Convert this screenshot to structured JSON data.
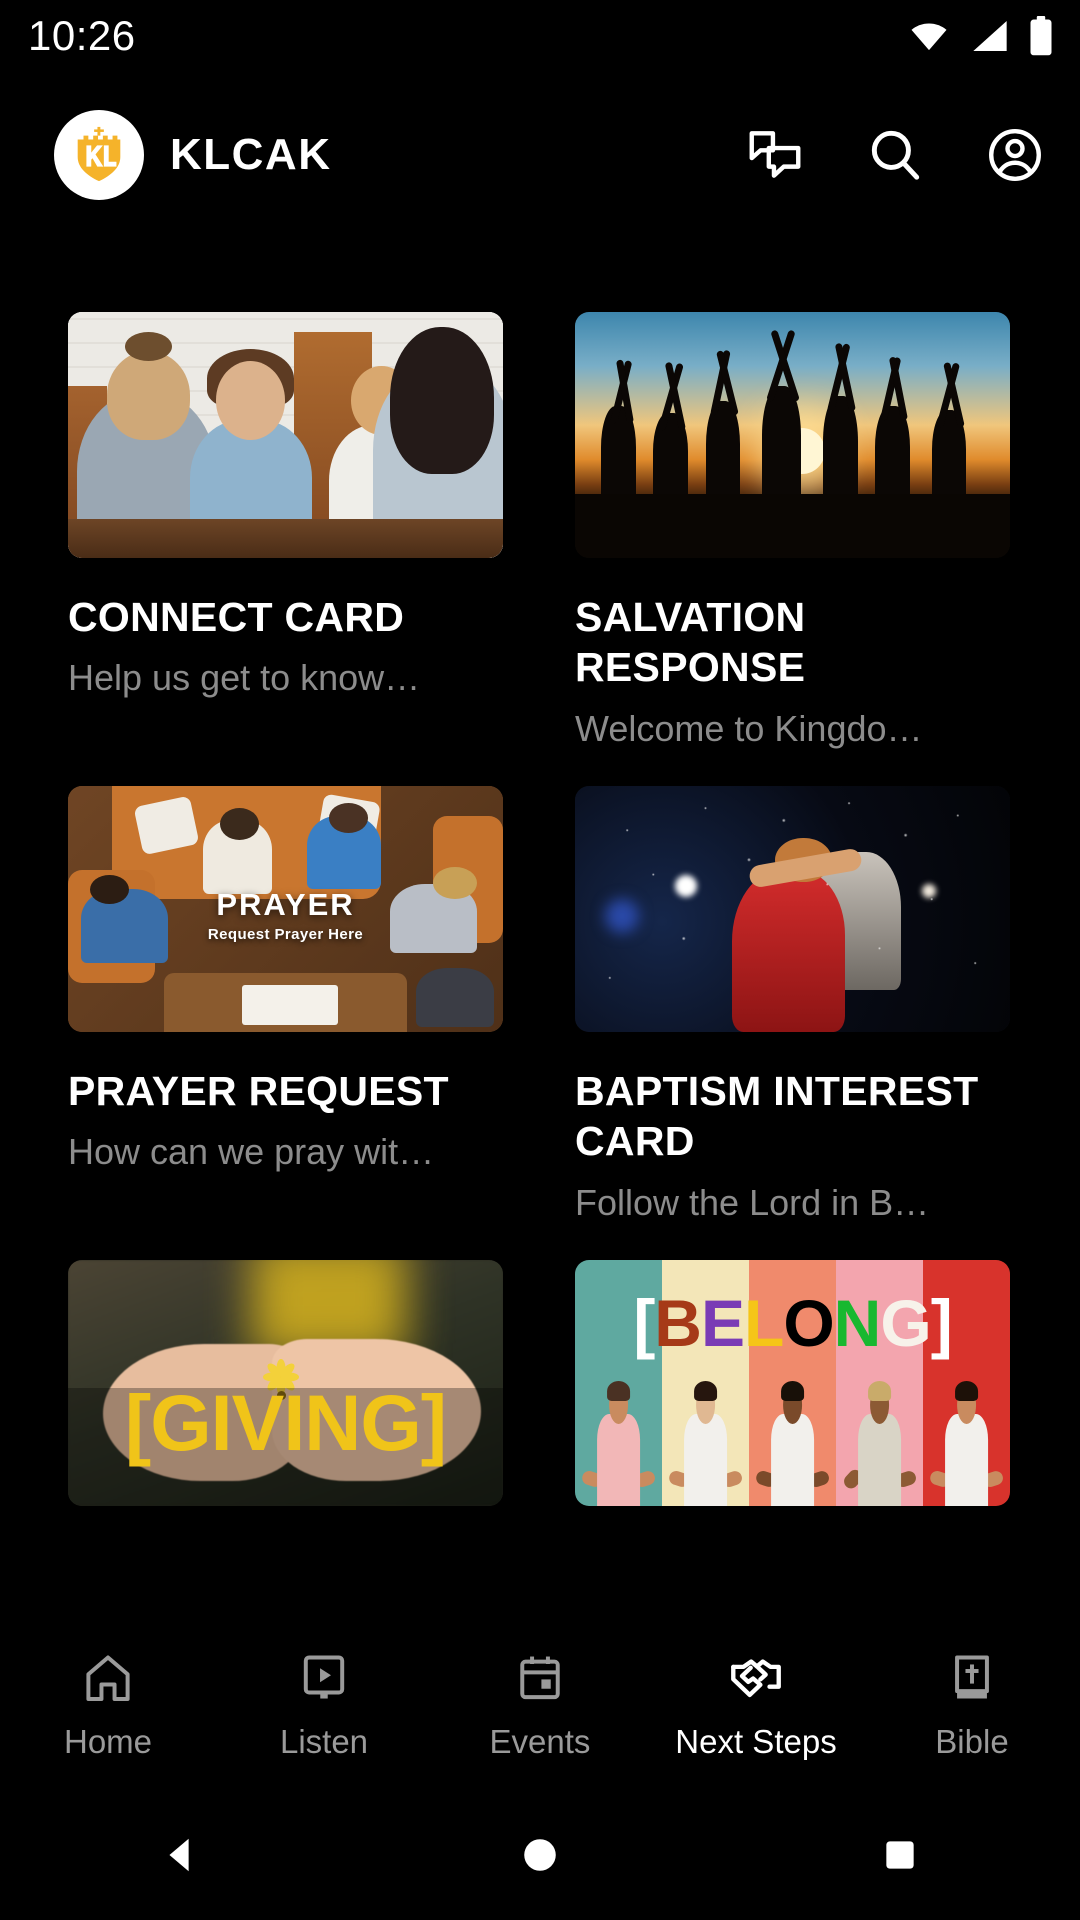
{
  "status_bar": {
    "time": "10:26",
    "icons": [
      "wifi-icon",
      "cellular-signal-icon",
      "battery-icon"
    ]
  },
  "header": {
    "logo_alt": "klcak-logo",
    "brand_name": "KLCAK",
    "logo_color": "#f5b32a",
    "actions": [
      {
        "name": "chat-icon",
        "label": "Chat"
      },
      {
        "name": "search-icon",
        "label": "Search"
      },
      {
        "name": "account-icon",
        "label": "Account"
      }
    ]
  },
  "cards": [
    {
      "title": "CONNECT CARD",
      "subtitle": "Help us get to know…",
      "art": "people-at-table-photo"
    },
    {
      "title": "SALVATION RESPONSE",
      "subtitle": "Welcome to Kingdo…",
      "art": "raised-hands-sunset-photo"
    },
    {
      "title": "PRAYER REQUEST",
      "subtitle": "How can we pray wit…",
      "art": "prayer-circle-photo",
      "overlay_title": "PRAYER",
      "overlay_subtitle": "Request Prayer Here"
    },
    {
      "title": "BAPTISM INTEREST CARD",
      "subtitle": "Follow the Lord in B…",
      "art": "baptism-embrace-photo"
    },
    {
      "title": "",
      "subtitle": "",
      "art": "giving-hands-flower-photo",
      "overlay_title": "[GIVING]",
      "overlay_color": "#f0c419"
    },
    {
      "title": "",
      "subtitle": "",
      "art": "belong-people-stripes-photo",
      "overlay_letters": [
        {
          "char": "[",
          "color": "#ffffff"
        },
        {
          "char": "B",
          "color": "#a63a18"
        },
        {
          "char": "E",
          "color": "#7a3bb5"
        },
        {
          "char": "L",
          "color": "#f5c518"
        },
        {
          "char": "O",
          "color": "#000000"
        },
        {
          "char": "N",
          "color": "#18b830"
        },
        {
          "char": "G",
          "color": "#f7f2ea"
        },
        {
          "char": "]",
          "color": "#ffffff"
        }
      ],
      "stripe_colors": [
        "#5fa9a0",
        "#f3e6b8",
        "#f08a6c",
        "#f3a5ae",
        "#d8332c"
      ]
    }
  ],
  "tab_bar": {
    "active": "Next Steps",
    "items": [
      {
        "label": "Home",
        "icon": "home-icon"
      },
      {
        "label": "Listen",
        "icon": "media-play-icon"
      },
      {
        "label": "Events",
        "icon": "calendar-icon"
      },
      {
        "label": "Next Steps",
        "icon": "handshake-icon"
      },
      {
        "label": "Bible",
        "icon": "bible-book-icon"
      }
    ]
  },
  "android_nav": {
    "buttons": [
      {
        "name": "back-button",
        "icon": "triangle-back-icon"
      },
      {
        "name": "home-button",
        "icon": "circle-home-icon"
      },
      {
        "name": "recents-button",
        "icon": "square-recents-icon"
      }
    ]
  }
}
